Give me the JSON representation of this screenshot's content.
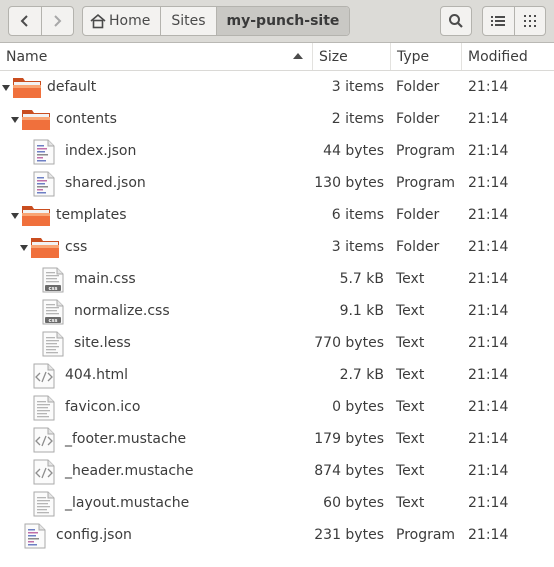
{
  "toolbar": {
    "back_icon": "go-back-icon",
    "forward_icon": "go-forward-icon",
    "search_icon": "search-icon",
    "list_view_icon": "list-view-icon",
    "grid_view_icon": "grid-view-icon"
  },
  "pathbar": {
    "home_icon": "home-icon",
    "crumbs": [
      "Home",
      "Sites",
      "my-punch-site"
    ]
  },
  "columns": {
    "name": "Name",
    "size": "Size",
    "type": "Type",
    "modified": "Modified"
  },
  "files": [
    {
      "name": "default",
      "size": "3 items",
      "type": "Folder",
      "modified": "21:14",
      "icon": "folder-icon"
    },
    {
      "name": "contents",
      "size": "2 items",
      "type": "Folder",
      "modified": "21:14",
      "icon": "folder-icon"
    },
    {
      "name": "index.json",
      "size": "44 bytes",
      "type": "Program",
      "modified": "21:14",
      "icon": "json-file-icon"
    },
    {
      "name": "shared.json",
      "size": "130 bytes",
      "type": "Program",
      "modified": "21:14",
      "icon": "json-file-icon"
    },
    {
      "name": "templates",
      "size": "6 items",
      "type": "Folder",
      "modified": "21:14",
      "icon": "folder-icon"
    },
    {
      "name": "css",
      "size": "3 items",
      "type": "Folder",
      "modified": "21:14",
      "icon": "folder-icon"
    },
    {
      "name": "main.css",
      "size": "5.7 kB",
      "type": "Text",
      "modified": "21:14",
      "icon": "css-file-icon"
    },
    {
      "name": "normalize.css",
      "size": "9.1 kB",
      "type": "Text",
      "modified": "21:14",
      "icon": "css-file-icon"
    },
    {
      "name": "site.less",
      "size": "770 bytes",
      "type": "Text",
      "modified": "21:14",
      "icon": "text-file-icon"
    },
    {
      "name": "404.html",
      "size": "2.7 kB",
      "type": "Text",
      "modified": "21:14",
      "icon": "html-file-icon"
    },
    {
      "name": "favicon.ico",
      "size": "0 bytes",
      "type": "Text",
      "modified": "21:14",
      "icon": "text-file-icon"
    },
    {
      "name": "_footer.mustache",
      "size": "179 bytes",
      "type": "Text",
      "modified": "21:14",
      "icon": "html-file-icon"
    },
    {
      "name": "_header.mustache",
      "size": "874 bytes",
      "type": "Text",
      "modified": "21:14",
      "icon": "html-file-icon"
    },
    {
      "name": "_layout.mustache",
      "size": "60 bytes",
      "type": "Text",
      "modified": "21:14",
      "icon": "text-file-icon"
    },
    {
      "name": "config.json",
      "size": "231 bytes",
      "type": "Program",
      "modified": "21:14",
      "icon": "json-file-icon"
    }
  ],
  "colors": {
    "folder_orange": "#f0703c",
    "folder_light": "#f9a574",
    "headerbar": "#dcdbd7"
  }
}
